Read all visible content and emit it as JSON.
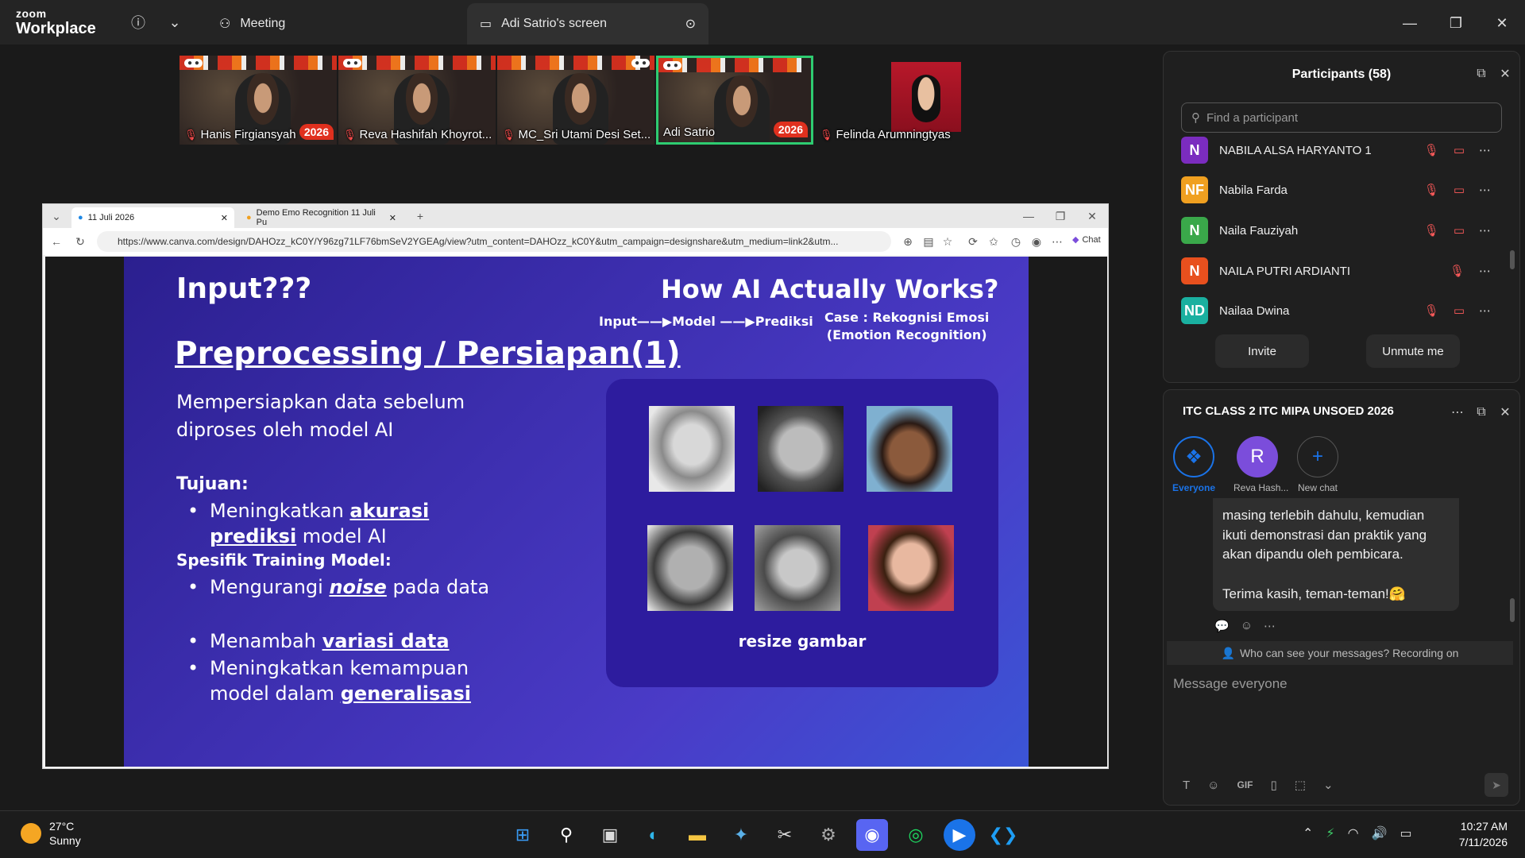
{
  "titlebar": {
    "brand_small": "zoom",
    "brand_big": "Workplace",
    "meeting_label": "Meeting",
    "screen_tab_label": "Adi Satrio's screen"
  },
  "thumbnails": [
    {
      "name": "Hanis Firgiansyah",
      "badge": "2026"
    },
    {
      "name": "Reva Hashifah Khoyrot...",
      "badge": ""
    },
    {
      "name": "MC_Sri Utami Desi Set...",
      "badge": ""
    },
    {
      "name": "Adi Satrio",
      "badge": "2026"
    },
    {
      "name": "Felinda Arumningtyas",
      "badge": ""
    }
  ],
  "browser": {
    "tab1": "11 Juli 2026",
    "tab2": "Demo Emo Recognition 11 Juli Pu",
    "url": "https://www.canva.com/design/DAHOzz_kC0Y/Y96zg71LF76bmSeV2YGEAg/view?utm_content=DAHOzz_kC0Y&utm_campaign=designshare&utm_medium=link2&utm...",
    "chat_label": "Chat"
  },
  "slide": {
    "input_title": "Input???",
    "how_title": "How AI Actually Works?",
    "flow": "Input——▶Model  ——▶Prediksi",
    "case_line1": "Case : Rekognisi Emosi",
    "case_line2": "(Emotion Recognition)",
    "pre_title": "Preprocessing / Persiapan(1)",
    "desc": "Mempersiapkan data sebelum diproses oleh model AI",
    "tujuan": "Tujuan:",
    "bullet1_a": "Meningkatkan ",
    "bullet1_b": "akurasi prediksi",
    "bullet1_c": " model AI",
    "spesifik": "Spesifik Training Model:",
    "bullet2_a": "Mengurangi ",
    "bullet2_b": "noise",
    "bullet2_c": " pada data",
    "bullet3_a": "Menambah ",
    "bullet3_b": "variasi data",
    "bullet4_a": "Meningkatkan kemampuan model dalam ",
    "bullet4_b": "generalisasi",
    "resize": "resize gambar"
  },
  "participants": {
    "title": "Participants (58)",
    "search_placeholder": "Find a participant",
    "rows": [
      {
        "initials": "N",
        "name": "NABILA ALSA HARYANTO 1",
        "color": "#7b2cbf"
      },
      {
        "initials": "NF",
        "name": "Nabila Farda",
        "color": "#f0a020"
      },
      {
        "initials": "N",
        "name": "Naila Fauziyah",
        "color": "#3aa84a"
      },
      {
        "initials": "N",
        "name": "NAILA PUTRI ARDIANTI",
        "color": "#e8501e"
      },
      {
        "initials": "ND",
        "name": "Nailaa Dwina",
        "color": "#1ab0a0"
      }
    ],
    "invite": "Invite",
    "unmute": "Unmute me"
  },
  "chat": {
    "title": "ITC CLASS 2 ITC MIPA UNSOED 2026",
    "tabs": [
      {
        "label": "Everyone",
        "glyph": "❖"
      },
      {
        "label": "Reva Hash...",
        "glyph": "R"
      },
      {
        "label": "New chat",
        "glyph": "+"
      }
    ],
    "message": "masing terlebih dahulu, kemudian ikuti demonstrasi dan praktik yang akan dipandu oleh pembicara.\n\nTerima kasih, teman-teman!🤗",
    "who_can_see": "Who can see your messages? Recording on",
    "compose_placeholder": "Message everyone",
    "gif": "GIF"
  },
  "taskbar": {
    "temp": "27°C",
    "weather": "Sunny",
    "time": "10:27 AM",
    "date": "7/11/2026"
  }
}
